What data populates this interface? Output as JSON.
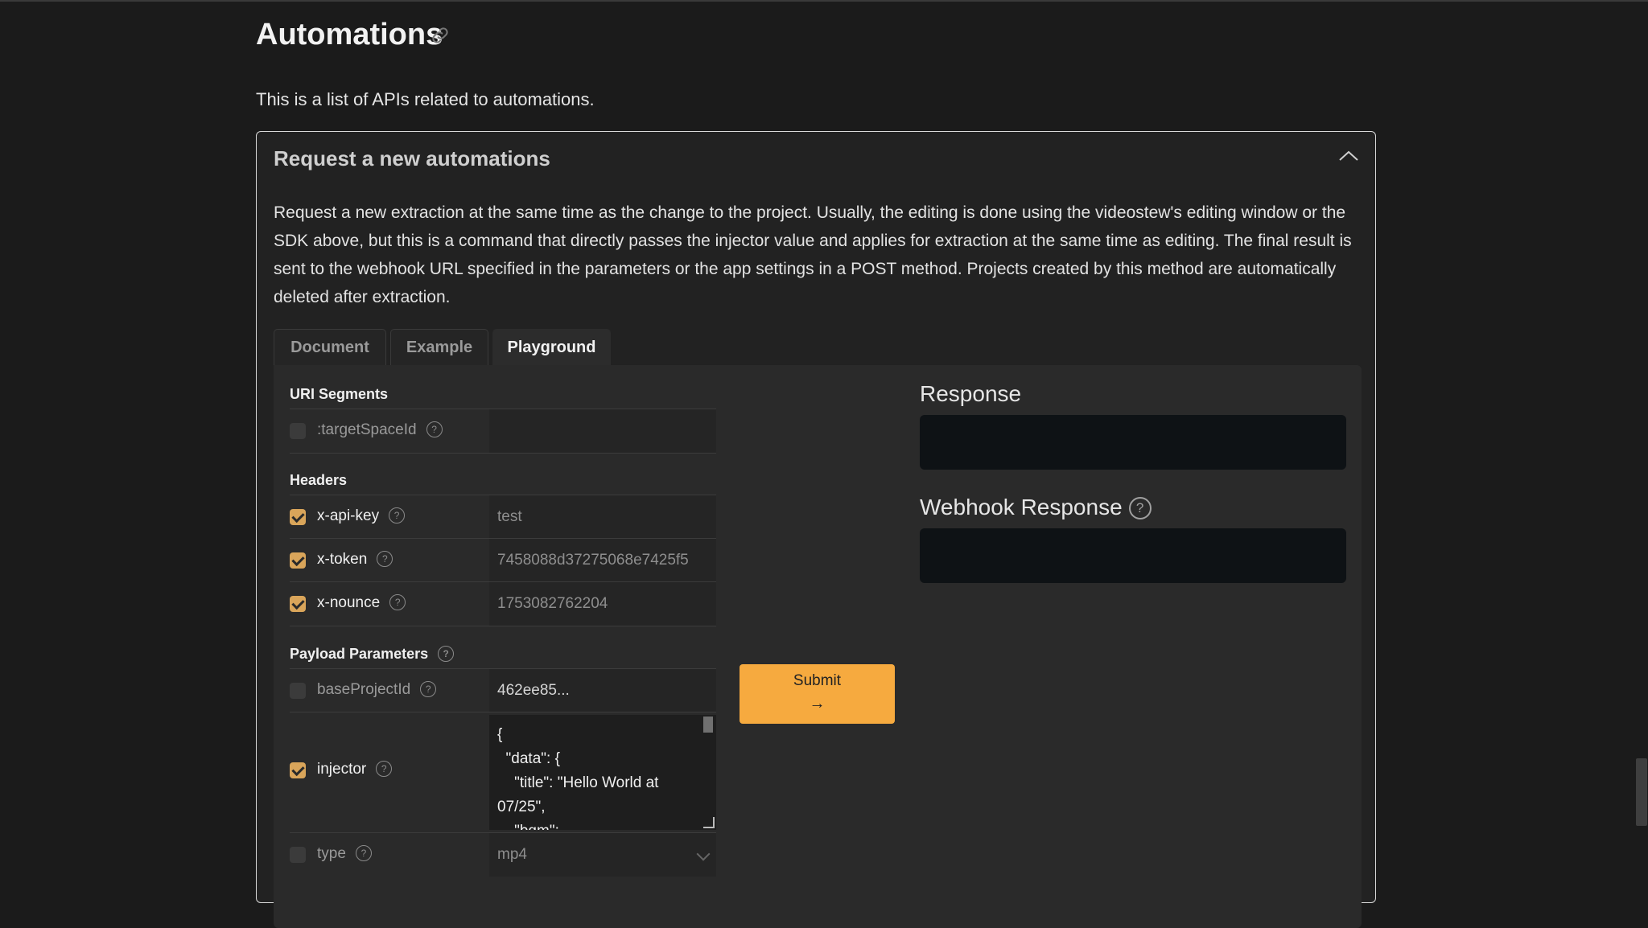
{
  "page": {
    "title": "Automations",
    "description": "This is a list of APIs related to automations."
  },
  "card": {
    "title": "Request a new automations",
    "description": "Request a new extraction at the same time as the change to the project. Usually, the editing is done using the videostew's editing window or the SDK above, but this is a command that directly passes the injector value and applies for extraction at the same time as editing. The final result is sent to the webhook URL specified in the parameters or the app settings in a POST method. Projects created by this method are automatically deleted after extraction."
  },
  "tabs": [
    {
      "label": "Document",
      "active": false
    },
    {
      "label": "Example",
      "active": false
    },
    {
      "label": "Playground",
      "active": true
    }
  ],
  "playground": {
    "uri_segments": {
      "title": "URI Segments",
      "rows": [
        {
          "label": ":targetSpaceId",
          "checked": false,
          "value": ""
        }
      ]
    },
    "headers": {
      "title": "Headers",
      "rows": [
        {
          "label": "x-api-key",
          "checked": true,
          "value": "test"
        },
        {
          "label": "x-token",
          "checked": true,
          "value": "7458088d37275068e7425f5"
        },
        {
          "label": "x-nounce",
          "checked": true,
          "value": "1753082762204"
        }
      ]
    },
    "payload": {
      "title": "Payload Parameters",
      "rows": [
        {
          "label": "baseProjectId",
          "checked": false,
          "value": "462ee85..."
        },
        {
          "label": "injector",
          "checked": true,
          "json_lines": [
            "{",
            "  \"data\": {",
            "    \"title\": \"Hello World at",
            "07/25\",",
            "    \"bgm\":"
          ]
        },
        {
          "label": "type",
          "checked": false,
          "value": "mp4"
        }
      ]
    },
    "submit_label": "Submit",
    "submit_arrow": "→"
  },
  "response": {
    "title": "Response",
    "webhook_title": "Webhook Response"
  },
  "colors": {
    "background": "#1b1b1b",
    "accent": "#f6aa3f",
    "checkbox_on": "#d9a55a",
    "response_box": "#0e1215"
  }
}
